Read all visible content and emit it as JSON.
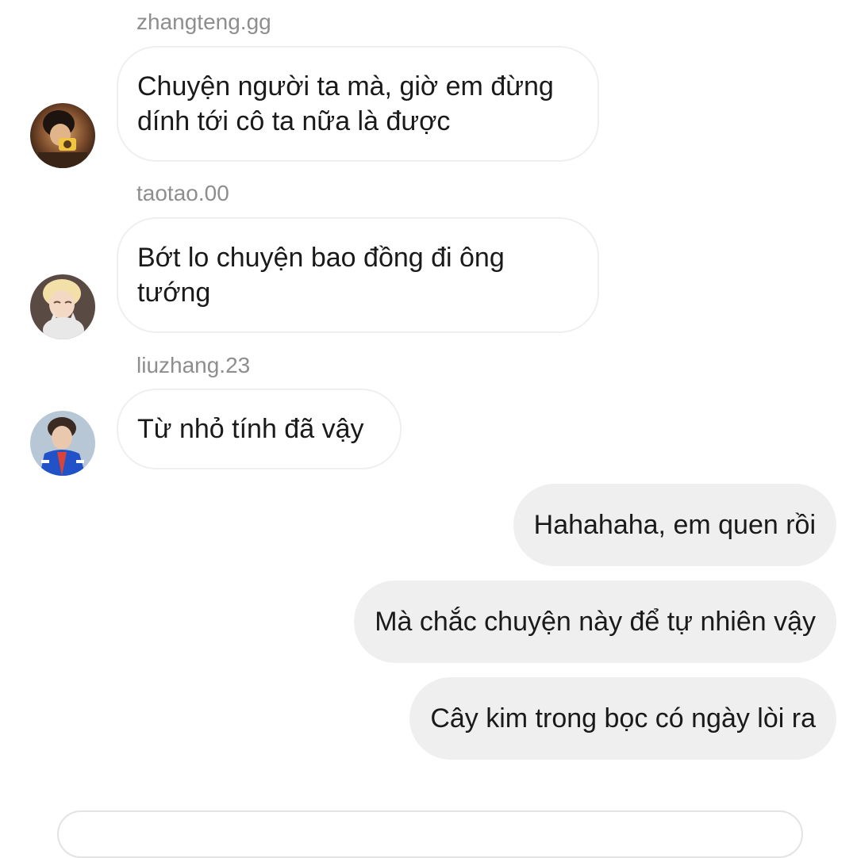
{
  "messages_in": [
    {
      "username": "zhangteng.gg",
      "text": "Chuyện người ta mà, giờ em đừng dính tới cô ta nữa là được",
      "avatar_icon": "avatar-photo-camera-person"
    },
    {
      "username": "taotao.00",
      "text": "Bớt lo chuyện bao đồng đi ông tướng",
      "avatar_icon": "avatar-photo-blonde-person-cat"
    },
    {
      "username": "liuzhang.23",
      "text": "Từ nhỏ tính đã vậy",
      "avatar_icon": "avatar-photo-person-blue-jacket"
    }
  ],
  "messages_out": [
    {
      "text": "Hahahaha, em quen rồi"
    },
    {
      "text": "Mà chắc chuyện này để tự nhiên vậy"
    },
    {
      "text": "Cây kim trong bọc có ngày lòi ra"
    }
  ],
  "colors": {
    "incoming_bubble_bg": "#ffffff",
    "incoming_bubble_border": "#efefef",
    "outgoing_bubble_bg": "#efefef",
    "username_text": "#8e8e8e",
    "message_text": "#1a1a1a"
  }
}
